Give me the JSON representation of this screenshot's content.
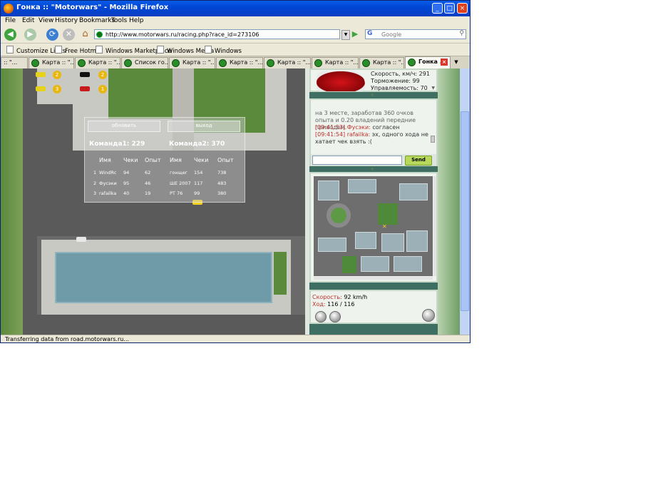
{
  "window": {
    "title": "Гонка :: \"Motorwars\" - Mozilla Firefox",
    "minimize": "_",
    "maximize": "□",
    "close": "×"
  },
  "menu": [
    "File",
    "Edit",
    "View",
    "History",
    "Bookmarks",
    "Tools",
    "Help"
  ],
  "nav": {
    "url": "http://www.motorwars.ru/racing.php?race_id=273106",
    "search_placeholder": "Google"
  },
  "bookmarks": [
    "Customize Links",
    "Free Hotmail",
    "Windows Marketplace",
    "Windows Media",
    "Windows"
  ],
  "tabs": [
    {
      "label": ":: \"..."
    },
    {
      "label": "Карта :: \"..."
    },
    {
      "label": "Карта :: \"..."
    },
    {
      "label": "Список го..."
    },
    {
      "label": "Карта :: \"..."
    },
    {
      "label": "Карта :: \"..."
    },
    {
      "label": "Карта :: \"..."
    },
    {
      "label": "Карта :: \"..."
    },
    {
      "label": "Карта :: \"..."
    },
    {
      "label": "Гонка ..."
    }
  ],
  "game": {
    "position_badges": [
      "2",
      "2",
      "3",
      "1"
    ],
    "overlay": {
      "refresh_button": "обновить",
      "exit_button": "выход",
      "team1_label": "Команда1:",
      "team1_score": "229",
      "team2_label": "Команда2:",
      "team2_score": "370",
      "headers": [
        "Имя",
        "Чеки",
        "Опыт",
        "Имя",
        "Чеки",
        "Опыт"
      ],
      "rows": [
        {
          "n": "1",
          "name1": "WindRc",
          "checks1": "94",
          "exp1": "62",
          "name2": "гонщег",
          "checks2": "154",
          "exp2": "738"
        },
        {
          "n": "2",
          "name1": "Фусэки",
          "checks1": "95",
          "exp1": "46",
          "name2": "ШЕ 2007",
          "checks2": "117",
          "exp2": "483"
        },
        {
          "n": "3",
          "name1": "rafailka",
          "checks1": "40",
          "exp1": "19",
          "name2": "РТ 76",
          "checks2": "99",
          "exp2": "380"
        }
      ]
    }
  },
  "car_panel": {
    "speed": "Скорость, км/ч: 291",
    "braking": "Торможение: 99",
    "handling": "Управляемость: 70"
  },
  "chat": {
    "message1": "на 3 месте, заработав 360 очков опыта и 0.20 владений передние приводом.",
    "time2": "[09:41:53]",
    "nick2": "Фусэки:",
    "msg2": "согласен",
    "time3": "[09:41:54]",
    "nick3": "rafailka:",
    "msg3": "эх, одного хода не хатает чек взять :(",
    "send_button": "Send"
  },
  "status_panel": {
    "speed_label": "Скорость:",
    "speed_value": "92 km/h",
    "moves_label": "Ход:",
    "moves_value": "116 / 116"
  },
  "statusbar": "Transferring data from road.motorwars.ru..."
}
